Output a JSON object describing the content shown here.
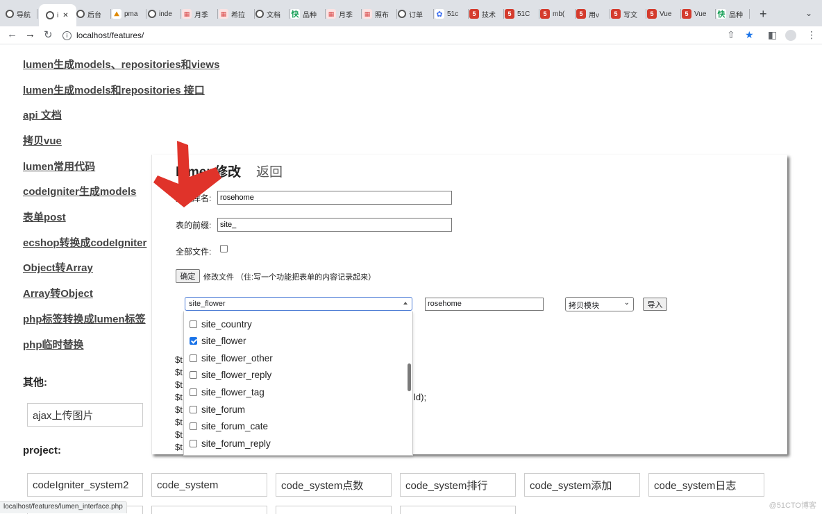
{
  "browser": {
    "tabs": [
      {
        "label": "导航",
        "favicon": "globe"
      },
      {
        "label": "i",
        "favicon": "globe",
        "active": true
      },
      {
        "label": "后台",
        "favicon": "globe"
      },
      {
        "label": "pma",
        "favicon": "pma"
      },
      {
        "label": "inde",
        "favicon": "globe"
      },
      {
        "label": "月季",
        "favicon": "pink"
      },
      {
        "label": "希拉",
        "favicon": "pink"
      },
      {
        "label": "文档",
        "favicon": "globe"
      },
      {
        "label": "品种",
        "favicon": "green"
      },
      {
        "label": "月季",
        "favicon": "pink"
      },
      {
        "label": "照布",
        "favicon": "pink"
      },
      {
        "label": "订单",
        "favicon": "globe"
      },
      {
        "label": "51c",
        "favicon": "blue"
      },
      {
        "label": "技术",
        "favicon": "red"
      },
      {
        "label": "51C",
        "favicon": "red"
      },
      {
        "label": "mb(",
        "favicon": "red"
      },
      {
        "label": "用v",
        "favicon": "red"
      },
      {
        "label": "写文",
        "favicon": "red"
      },
      {
        "label": "Vue",
        "favicon": "red"
      },
      {
        "label": "Vue",
        "favicon": "red"
      },
      {
        "label": "品种",
        "favicon": "green"
      }
    ],
    "new_tab": "+",
    "address": "localhost/features/",
    "status_url": "localhost/features/lumen_interface.php"
  },
  "nav_links": [
    "lumen生成models、repositories和views",
    "lumen生成models和repositories 接口",
    "api 文档",
    "拷贝vue",
    "lumen常用代码",
    "codeIgniter生成models",
    "表单post",
    "ecshop转换成codeIgniter",
    "Object转Array",
    "Array转Object",
    "php标签转换成lumen标签",
    "php临时替换"
  ],
  "other_section": {
    "title": "其他:",
    "items": [
      "ajax上传图片"
    ]
  },
  "project_section": {
    "title": "project:",
    "items": [
      "codeIgniter_system2",
      "code_system",
      "code_system点数",
      "code_system排行",
      "code_system添加",
      "code_system日志"
    ]
  },
  "modal": {
    "title": "lumen修改",
    "back_label": "返回",
    "db_label": "数据库名:",
    "db_value": "rosehome",
    "prefix_label": "表的前缀:",
    "prefix_value": "site_",
    "all_files_label": "全部文件:",
    "all_files_checked": false,
    "ok_label": "确定",
    "note": "修改文件 （住:写一个功能把表单的内容记录起来）",
    "table_select_value": "site_flower",
    "db_value2": "rosehome",
    "module_select_value": "拷贝模块",
    "import_label": "导入",
    "code_lines": [
      "$t",
      "$t",
      "$t",
      "$t",
      "$t",
      "$t",
      "$t",
      "$t"
    ],
    "code_tail": "ld);",
    "dropdown_items": [
      {
        "label": "site_country",
        "checked": false
      },
      {
        "label": "site_flower",
        "checked": true
      },
      {
        "label": "site_flower_other",
        "checked": false
      },
      {
        "label": "site_flower_reply",
        "checked": false
      },
      {
        "label": "site_flower_tag",
        "checked": false
      },
      {
        "label": "site_forum",
        "checked": false
      },
      {
        "label": "site_forum_cate",
        "checked": false
      },
      {
        "label": "site_forum_reply",
        "checked": false
      }
    ]
  },
  "watermark": "@51CTO博客",
  "colors": {
    "arrow": "#e0332a",
    "accent": "#1a73e8"
  }
}
